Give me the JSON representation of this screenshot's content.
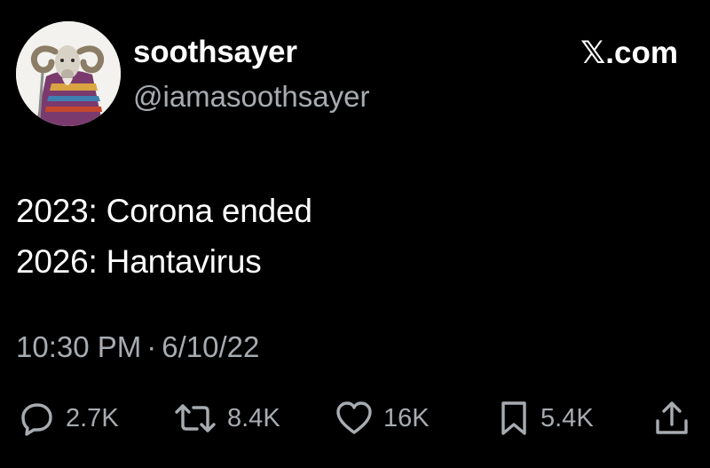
{
  "author": {
    "display_name": "soothsayer",
    "handle": "@iamasoothsayer",
    "avatar_icon": "ram-soothsayer-avatar"
  },
  "brand": {
    "label": "𝕏.com"
  },
  "tweet": {
    "lines": [
      "2023: Corona ended",
      "2026: Hantavirus"
    ],
    "time": "10:30 PM",
    "separator": "·",
    "date": "6/10/22"
  },
  "actions": {
    "reply": {
      "icon": "reply-bubble-icon",
      "count": "2.7K"
    },
    "repost": {
      "icon": "repost-arrows-icon",
      "count": "8.4K"
    },
    "like": {
      "icon": "heart-icon",
      "count": "16K"
    },
    "bookmark": {
      "icon": "bookmark-icon",
      "count": "5.4K"
    },
    "share": {
      "icon": "share-upload-icon"
    }
  },
  "colors": {
    "background": "#000000",
    "primary_text": "#ffffff",
    "secondary_text": "#a7acb1"
  }
}
